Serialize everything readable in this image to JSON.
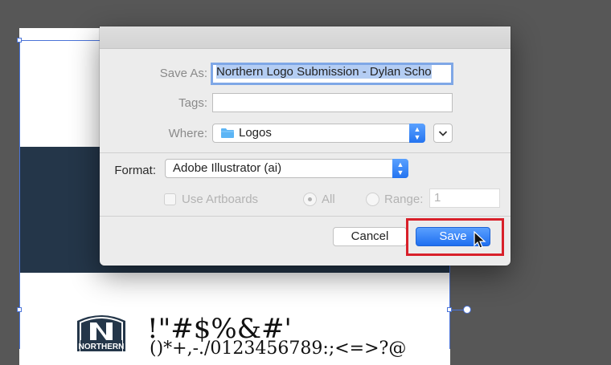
{
  "dialog": {
    "save_as_label": "Save As:",
    "save_as_value": "Northern Logo Submission - Dylan Scho",
    "tags_label": "Tags:",
    "tags_value": "",
    "where_label": "Where:",
    "where_value": "Logos",
    "format_label": "Format:",
    "format_value": "Adobe Illustrator (ai)",
    "use_artboards_label": "Use Artboards",
    "all_label": "All",
    "range_label": "Range:",
    "range_value": "1",
    "cancel_label": "Cancel",
    "save_label": "Save"
  },
  "canvas": {
    "logo_text": "NORTHERN",
    "glyph_line_1": "!\"#$%&#'",
    "glyph_line_2": "()*+,-./0123456789:;<=>?@"
  },
  "colors": {
    "accent": "#2474f0",
    "highlight": "#d8202a",
    "navy_band": "#243649",
    "selection": "#4a73d8"
  },
  "icons": {
    "where_folder": "folder-icon",
    "expand": "chevron-down-icon",
    "popup": "up-down-arrows-icon",
    "cursor": "mouse-pointer-icon"
  }
}
